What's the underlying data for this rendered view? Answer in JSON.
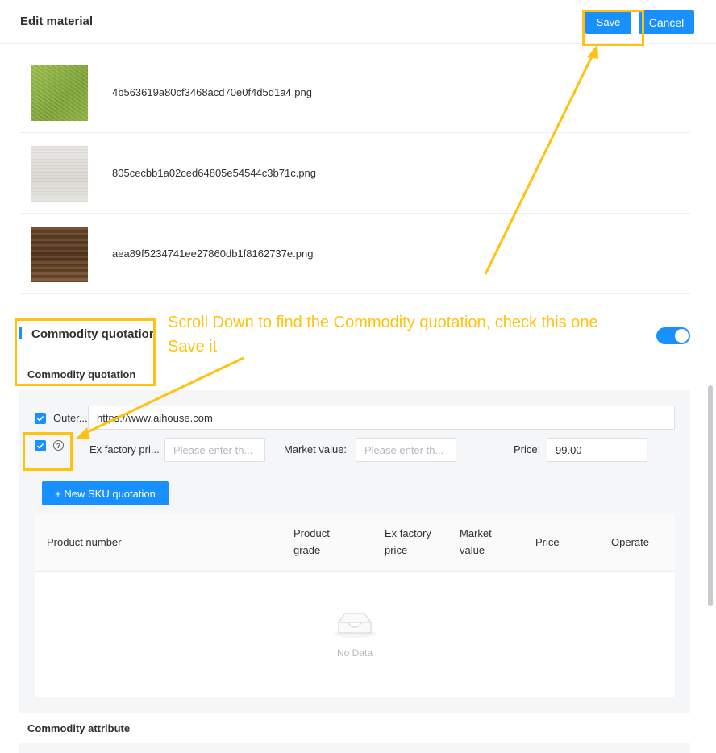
{
  "header": {
    "title": "Edit material",
    "save_label": "Save",
    "cancel_label": "Cancel"
  },
  "materials": [
    {
      "file": "4b563619a80cf3468acd70e0f4d5d1a4.png"
    },
    {
      "file": "805cecbb1a02ced64805e54544c3b71c.png"
    },
    {
      "file": "aea89f5234741ee27860db1f8162737e.png"
    }
  ],
  "section": {
    "title": "Commodity quotation",
    "subtitle": "Commodity quotation"
  },
  "quote": {
    "outer_label": "Outer...",
    "outer_value": "https://www.aihouse.com",
    "ex_factory_label": "Ex factory pri...",
    "ex_factory_placeholder": "Please enter th...",
    "market_label": "Market value:",
    "market_placeholder": "Please enter th...",
    "price_label": "Price:",
    "price_value": "99.00",
    "new_sku_label": "+ New SKU quotation"
  },
  "table": {
    "columns": [
      {
        "line1": "Product number",
        "line2": ""
      },
      {
        "line1": "Product",
        "line2": "grade"
      },
      {
        "line1": "Ex factory",
        "line2": "price"
      },
      {
        "line1": "Market",
        "line2": "value"
      },
      {
        "line1": "Price",
        "line2": ""
      },
      {
        "line1": "Operate",
        "line2": ""
      }
    ],
    "empty_text": "No Data"
  },
  "attribute": {
    "title": "Commodity attribute"
  },
  "annotation": {
    "line1": "Scroll Down to find the Commodity quotation, check this one",
    "line2": "Save it",
    "color": "#ffc20e"
  },
  "colors": {
    "primary": "#1890ff",
    "panel": "#f5f6f8"
  }
}
